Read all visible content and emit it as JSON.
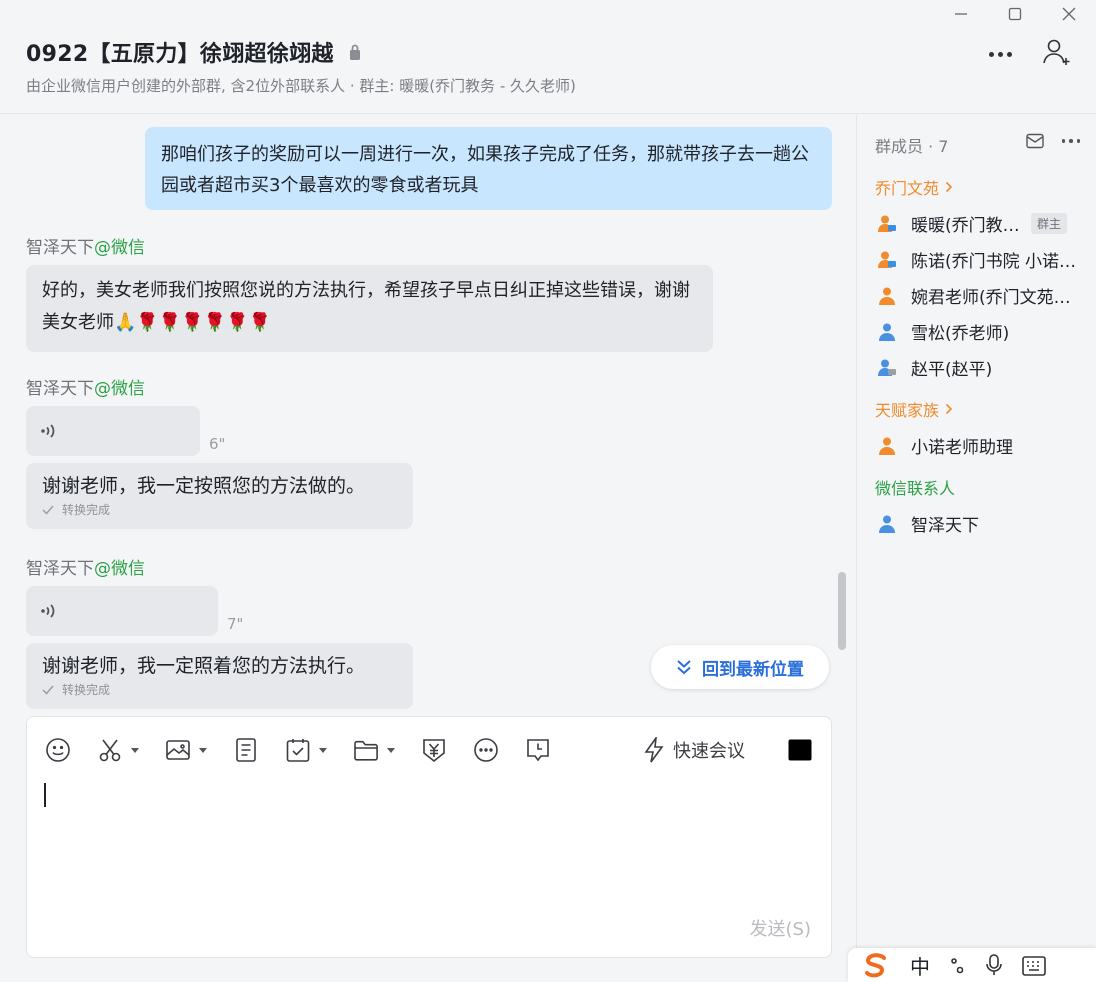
{
  "header": {
    "title": "0922【五原力】徐翊超徐翊越",
    "subtitle": "由企业微信用户创建的外部群, 含2位外部联系人 · 群主: 暖暖(乔门教务 - 久久老师)"
  },
  "messages": {
    "outgoing": "那咱们孩子的奖励可以一周进行一次，如果孩子完成了任务，那就带孩子去一趟公园或者超市买3个最喜欢的零食或者玩具",
    "sender_name": "智泽天下",
    "sender_tag": "@微信",
    "reply1": "好的，美女老师我们按照您说的方法执行，希望孩子早点日纠正掉这些错误，谢谢美女老师",
    "reply1_emoji": "🙏🌹🌹🌹🌹🌹🌹",
    "voice1_duration": "6\"",
    "voice1_transcript": "谢谢老师，我一定按照您的方法做的。",
    "transcript_status": "转换完成",
    "voice2_duration": "7\"",
    "voice2_transcript": "谢谢老师，我一定照着您的方法执行。",
    "jump_latest": "回到最新位置"
  },
  "composer": {
    "quick_meeting": "快速会议",
    "send": "发送(S)"
  },
  "members": {
    "header": "群成员 · 7",
    "groups": [
      {
        "title": "乔门文苑",
        "color": "#f08c2e",
        "members": [
          "暖暖(乔门教务 - 久久老师)",
          "陈诺(乔门书院   小诺老师)",
          "婉君老师(乔门文苑教务)",
          "雪松(乔老师)",
          "赵平(赵平)"
        ]
      },
      {
        "title": "天赋家族",
        "color": "#f08c2e",
        "members": [
          "小诺老师助理"
        ]
      },
      {
        "title": "微信联系人",
        "color": "#2ba245",
        "members": [
          "智泽天下"
        ]
      }
    ],
    "owner_badge": "群主"
  },
  "ime": {
    "mode": "中"
  },
  "colors": {
    "accent": "#2a6fdb",
    "outgoing_bubble": "#c9e6ff",
    "incoming_bubble": "#e6e8eb",
    "wechat_green": "#2ba245",
    "org_orange": "#f08c2e"
  }
}
